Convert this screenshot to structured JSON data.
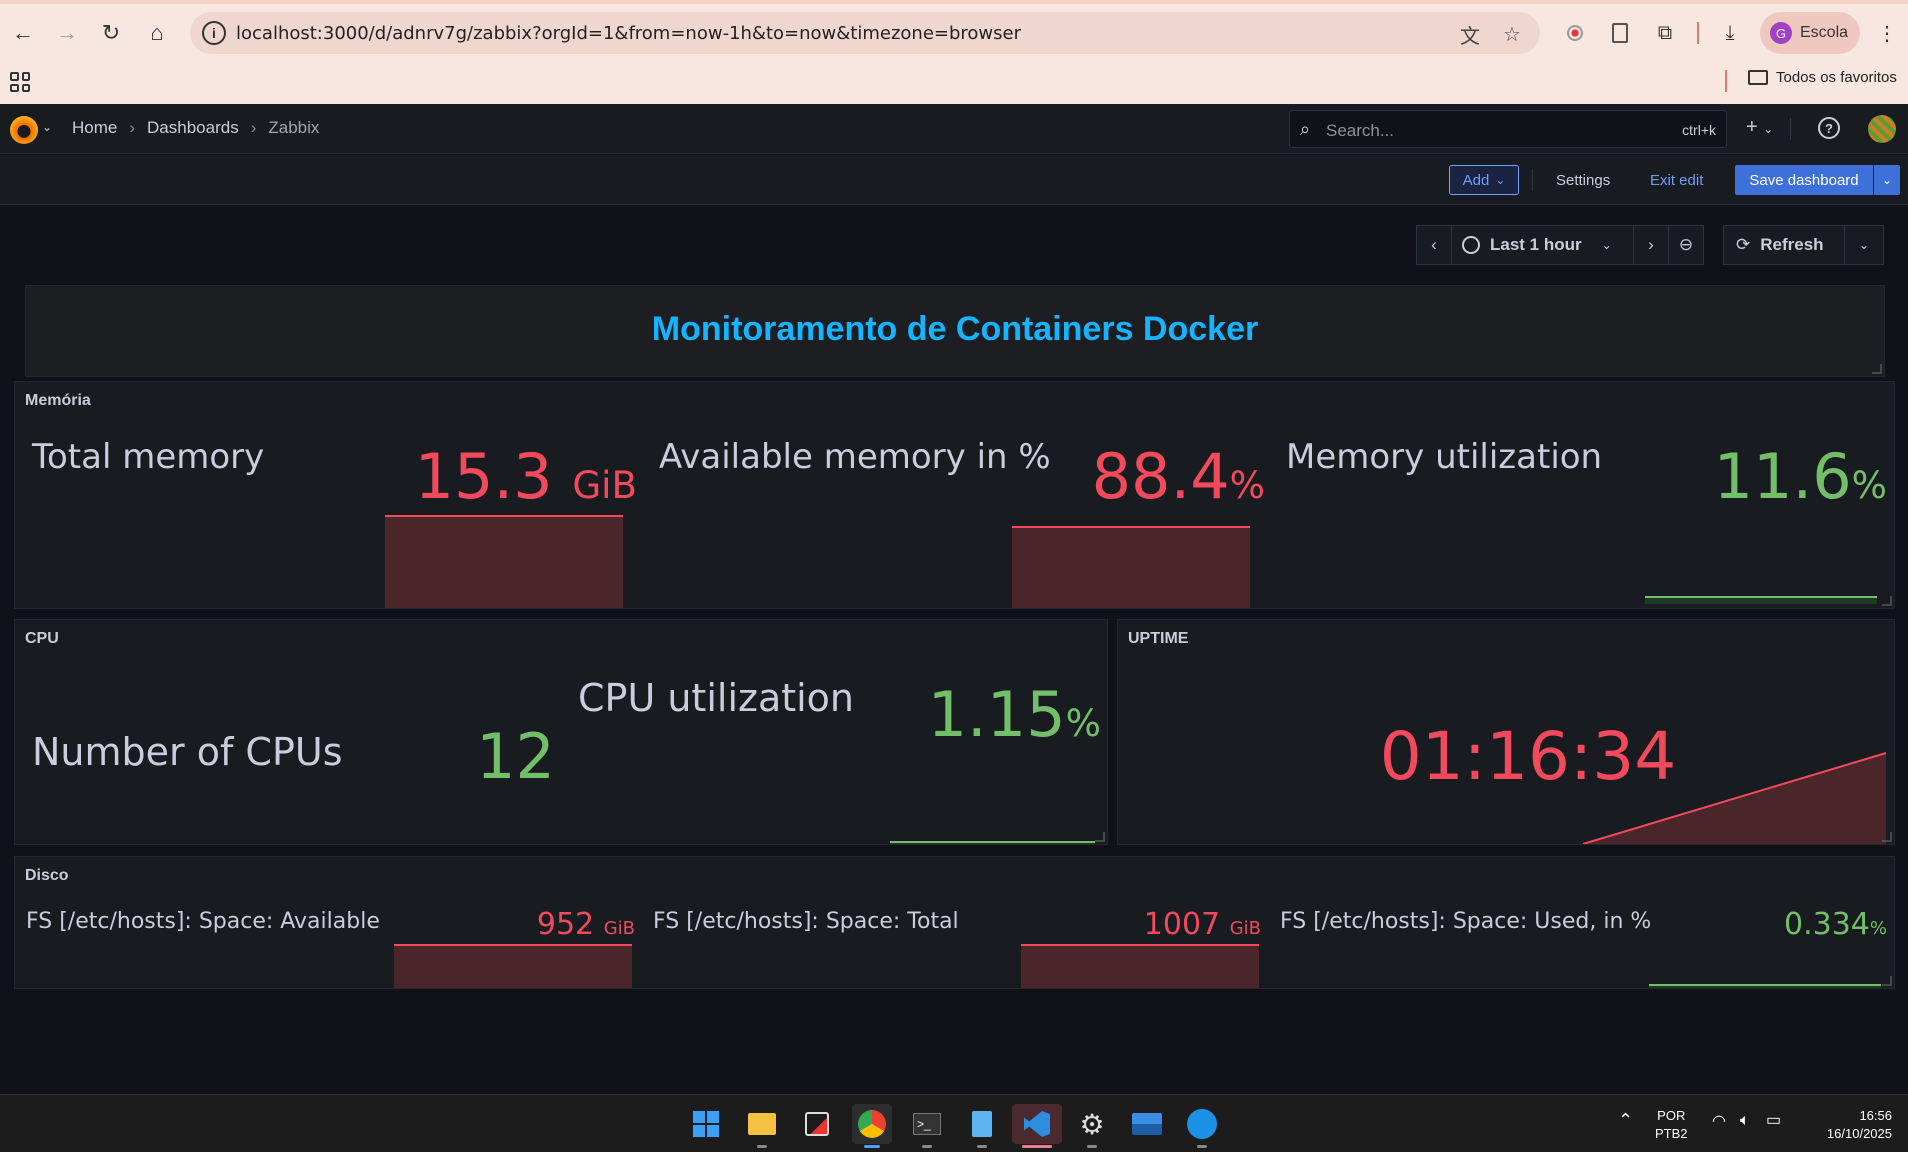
{
  "browser": {
    "url": "localhost:3000/d/adnrv7g/zabbix?orgId=1&from=now-1h&to=now&timezone=browser",
    "profile_initial": "G",
    "profile_name": "Escola",
    "bookmark_folder": "Todos os favoritos"
  },
  "grafana": {
    "breadcrumbs": [
      "Home",
      "Dashboards",
      "Zabbix"
    ],
    "search_placeholder": "Search...",
    "search_shortcut": "ctrl+k",
    "toolbar": {
      "add_label": "Add",
      "settings_label": "Settings",
      "exit_edit_label": "Exit edit",
      "save_label": "Save dashboard"
    },
    "time_range_label": "Last 1 hour",
    "refresh_label": "Refresh",
    "accent_color": "#3d71d9"
  },
  "dashboard": {
    "header_text": "Monitoramento de Containers Docker",
    "memory_row": {
      "title": "Memória",
      "stats": [
        {
          "name": "Total memory",
          "value": "15.3",
          "unit": "GiB",
          "color": "#f2495c"
        },
        {
          "name": "Available memory in %",
          "value": "88.4",
          "unit": "%",
          "color": "#f2495c"
        },
        {
          "name": "Memory utilization",
          "value": "11.6",
          "unit": "%",
          "color": "#73bf69"
        }
      ]
    },
    "cpu_row": {
      "title": "CPU",
      "stats": [
        {
          "name": "Number of CPUs",
          "value": "12",
          "unit": "",
          "color": "#73bf69"
        },
        {
          "name": "CPU utilization",
          "value": "1.15",
          "unit": "%",
          "color": "#73bf69"
        }
      ]
    },
    "uptime_row": {
      "title": "UPTIME",
      "value": "01:16:34",
      "color": "#f2495c"
    },
    "disk_row": {
      "title": "Disco",
      "stats": [
        {
          "name": "FS [/etc/hosts]: Space: Available",
          "value": "952",
          "unit": "GiB",
          "color": "#f2495c"
        },
        {
          "name": "FS [/etc/hosts]: Space: Total",
          "value": "1007",
          "unit": "GiB",
          "color": "#f2495c"
        },
        {
          "name": "FS [/etc/hosts]: Space: Used, in %",
          "value": "0.334",
          "unit": "%",
          "color": "#73bf69"
        }
      ]
    }
  },
  "taskbar": {
    "lang_top": "POR",
    "lang_bottom": "PTB2",
    "time": "16:56",
    "date": "16/10/2025"
  }
}
